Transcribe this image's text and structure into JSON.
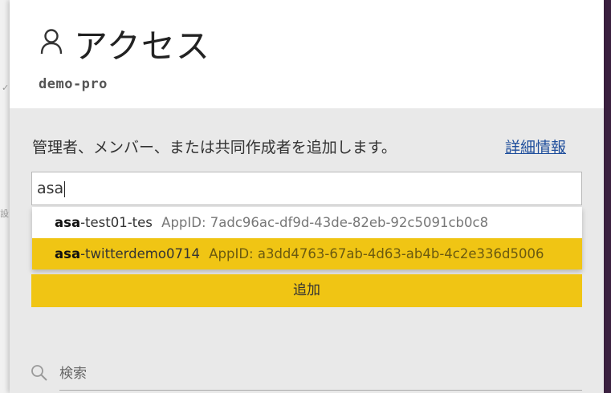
{
  "header": {
    "title": "アクセス",
    "subtitle": "demo-pro",
    "icon": "user-icon"
  },
  "add_section": {
    "description": "管理者、メンバー、または共同作成者を追加します。",
    "learn_more": "詳細情報",
    "input_value": "asa",
    "suggestions": [
      {
        "match": "asa",
        "rest": "-test01-tes",
        "appid": "AppID: 7adc96ac-df9d-43de-82eb-92c5091cb0c8",
        "highlighted": false
      },
      {
        "match": "asa",
        "rest": "-twitterdemo0714",
        "appid": "AppID: a3dd4763-67ab-4d63-ab4b-4c2e336d5006",
        "highlighted": true
      }
    ],
    "add_button": "追加"
  },
  "search": {
    "placeholder": "検索",
    "icon": "search-icon"
  },
  "colors": {
    "accent": "#f0c514",
    "link": "#1f4e9c",
    "panel_bg": "#e9e9e9"
  }
}
